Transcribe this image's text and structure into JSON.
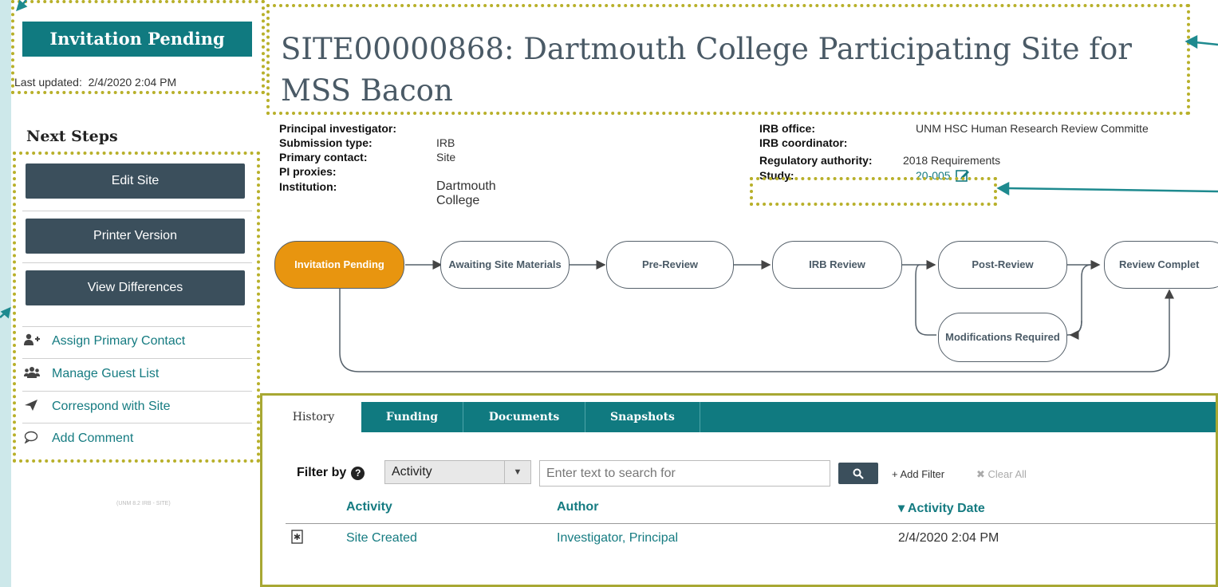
{
  "sidebar": {
    "state": "Invitation Pending",
    "last_updated_label": "Last updated:",
    "last_updated_value": "2/4/2020 2:04 PM",
    "next_steps_heading": "Next Steps",
    "buttons": [
      {
        "label": "Edit Site"
      },
      {
        "label": "Printer Version"
      },
      {
        "label": "View Differences"
      }
    ],
    "links": [
      {
        "label": "Assign Primary Contact",
        "icon": "add-user-icon"
      },
      {
        "label": "Manage Guest List",
        "icon": "group-icon"
      },
      {
        "label": "Correspond with Site",
        "icon": "paper-plane-icon"
      },
      {
        "label": "Add Comment",
        "icon": "comment-icon"
      }
    ],
    "footer_note": "(UNM 8.2 IRB - SITE)"
  },
  "header": {
    "title": "SITE00000868: Dartmouth College Participating Site for MSS Bacon"
  },
  "details_left": [
    {
      "key": "Principal investigator:",
      "value": ""
    },
    {
      "key": "Submission type:",
      "value": "IRB Site"
    },
    {
      "key": "Primary contact:",
      "value": ""
    },
    {
      "key": "PI proxies:",
      "value": ""
    },
    {
      "key": "Institution:",
      "value": "Dartmouth College"
    }
  ],
  "details_right": [
    {
      "key": "IRB office:",
      "value": "UNM HSC Human Research Review Committe"
    },
    {
      "key": "IRB coordinator:",
      "value": ""
    },
    {
      "key": "Regulatory authority:",
      "value": "2018 Requirements"
    },
    {
      "key": "Study:",
      "value": "20-005"
    }
  ],
  "workflow": {
    "nodes": [
      "Invitation Pending",
      "Awaiting Site Materials",
      "Pre-Review",
      "IRB Review",
      "Post-Review",
      "Review Complet",
      "Modifications Required"
    ],
    "active": "Invitation Pending"
  },
  "tabs": [
    "History",
    "Funding",
    "Documents",
    "Snapshots"
  ],
  "filter": {
    "label": "Filter by",
    "select_value": "Activity",
    "search_placeholder": "Enter text to search for",
    "add_filter": "+ Add Filter",
    "clear_all": "✖ Clear All"
  },
  "table": {
    "headers": [
      "Activity",
      "Author",
      "▾ Activity Date"
    ],
    "rows": [
      {
        "activity": "Site Created",
        "author": "Investigator, Principal",
        "date": "2/4/2020 2:04 PM"
      }
    ]
  },
  "colors": {
    "teal": "#107a80",
    "active_state": "#e8950f",
    "button": "#3b4f5c",
    "highlight": "#b8b02a"
  }
}
